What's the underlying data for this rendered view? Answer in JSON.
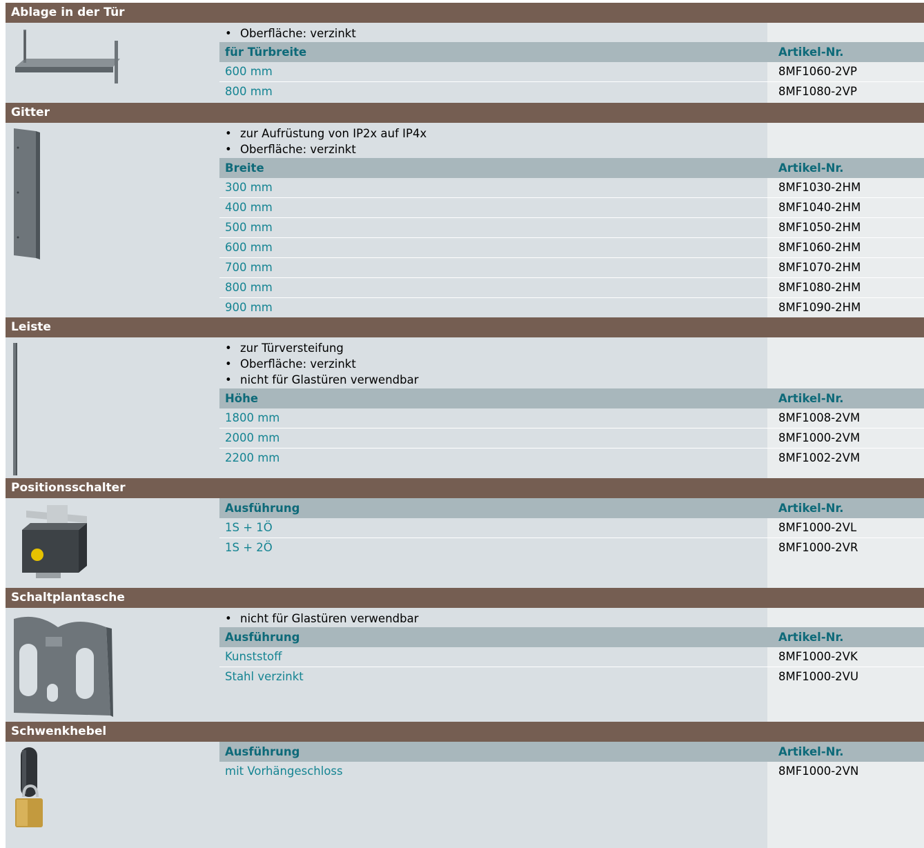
{
  "sections": [
    {
      "title": "Ablage in der Tür",
      "bullets": [
        "Oberfläche: verzinkt"
      ],
      "col1": "für Türbreite",
      "col2": "Artikel-Nr.",
      "rows": [
        {
          "value": "600 mm",
          "article": "8MF1060-2VP"
        },
        {
          "value": "800 mm",
          "article": "8MF1080-2VP"
        }
      ]
    },
    {
      "title": "Gitter",
      "bullets": [
        "zur Aufrüstung von IP2x auf IP4x",
        "Oberfläche: verzinkt"
      ],
      "col1": "Breite",
      "col2": "Artikel-Nr.",
      "rows": [
        {
          "value": "300 mm",
          "article": "8MF1030-2HM"
        },
        {
          "value": "400 mm",
          "article": "8MF1040-2HM"
        },
        {
          "value": "500 mm",
          "article": "8MF1050-2HM"
        },
        {
          "value": "600 mm",
          "article": "8MF1060-2HM"
        },
        {
          "value": "700 mm",
          "article": "8MF1070-2HM"
        },
        {
          "value": "800 mm",
          "article": "8MF1080-2HM"
        },
        {
          "value": "900 mm",
          "article": "8MF1090-2HM"
        }
      ]
    },
    {
      "title": "Leiste",
      "bullets": [
        "zur Türversteifung",
        "Oberfläche: verzinkt",
        "nicht für Glastüren verwendbar"
      ],
      "col1": "Höhe",
      "col2": "Artikel-Nr.",
      "rows": [
        {
          "value": "1800 mm",
          "article": "8MF1008-2VM"
        },
        {
          "value": "2000 mm",
          "article": "8MF1000-2VM"
        },
        {
          "value": "2200 mm",
          "article": "8MF1002-2VM"
        }
      ]
    },
    {
      "title": "Positionsschalter",
      "bullets": [],
      "col1": "Ausführung",
      "col2": "Artikel-Nr.",
      "rows": [
        {
          "value": "1S + 1Ö",
          "article": "8MF1000-2VL"
        },
        {
          "value": "1S + 2Ö",
          "article": "8MF1000-2VR"
        }
      ]
    },
    {
      "title": "Schaltplantasche",
      "bullets": [
        "nicht für Glastüren verwendbar"
      ],
      "col1": "Ausführung",
      "col2": "Artikel-Nr.",
      "rows": [
        {
          "value": "Kunststoff",
          "article": "8MF1000-2VK"
        },
        {
          "value": "Stahl verzinkt",
          "article": "8MF1000-2VU"
        }
      ]
    },
    {
      "title": "Schwenkhebel",
      "bullets": [],
      "col1": "Ausführung",
      "col2": "Artikel-Nr.",
      "rows": [
        {
          "value": "mit Vorhängeschloss",
          "article": "8MF1000-2VN"
        }
      ]
    }
  ],
  "colors": {
    "header_bg": "#755e52",
    "body_bg": "#d9dfe3",
    "article_col_bg": "#eaedee",
    "table_header_bg": "#a8b7bc",
    "accent_teal": "#158492"
  }
}
